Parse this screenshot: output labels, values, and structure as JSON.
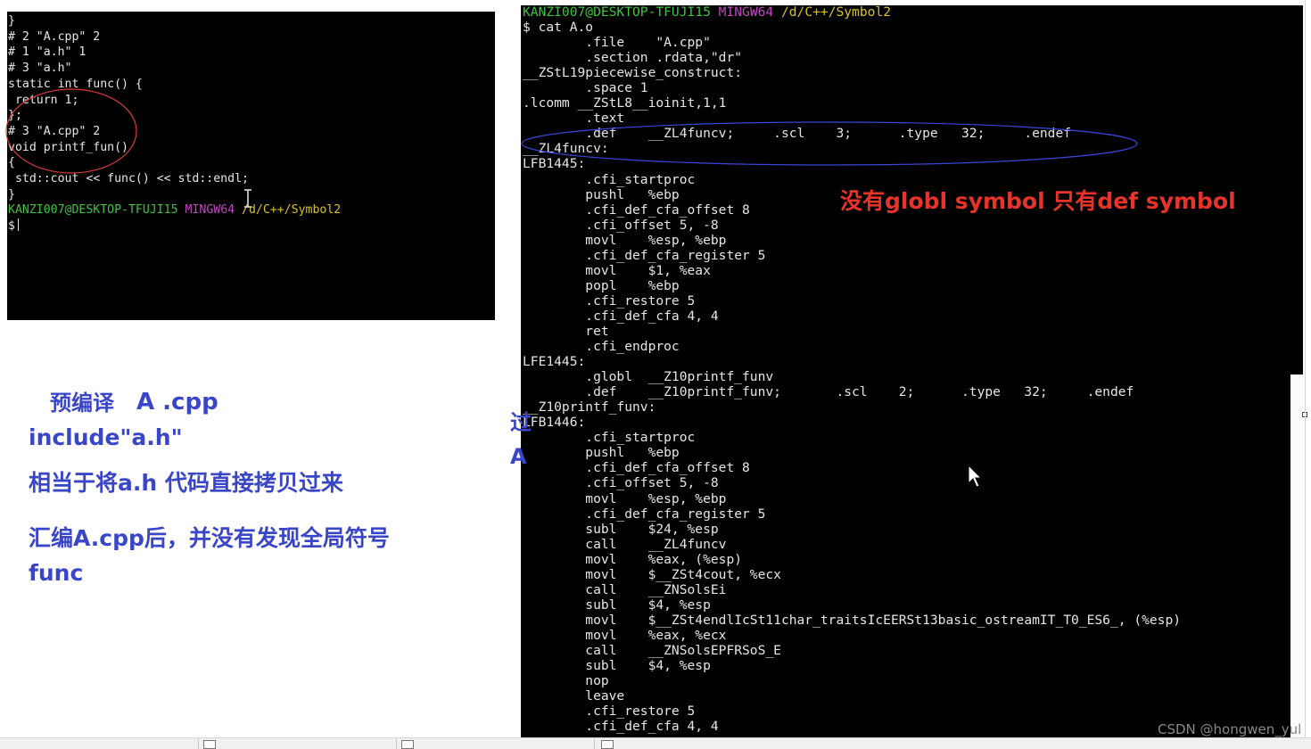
{
  "left_terminal": {
    "lines": [
      {
        "text": "}"
      },
      {
        "text": "# 2 \"A.cpp\" 2"
      },
      {
        "text": "# 1 \"a.h\" 1"
      },
      {
        "text": ""
      },
      {
        "text": ""
      },
      {
        "text": ""
      },
      {
        "text": "# 3 \"a.h\""
      },
      {
        "text": "static int func() {"
      },
      {
        "text": ""
      },
      {
        "text": " return 1;"
      },
      {
        "text": "};"
      },
      {
        "text": "# 3 \"A.cpp\" 2"
      },
      {
        "text": "void printf_fun()"
      },
      {
        "text": "{"
      },
      {
        "text": " std::cout << func() << std::endl;"
      },
      {
        "text": "}"
      },
      {
        "text": ""
      }
    ],
    "prompt_user": "KANZI007@DESKTOP-TFUJI15",
    "prompt_shell": "MINGW64",
    "prompt_path": "/d/C++/Symbol2",
    "prompt_symbol": "$"
  },
  "right_terminal": {
    "prompt_user": "KANZI007@DESKTOP-TFUJI15",
    "prompt_shell": "MINGW64",
    "prompt_path": "/d/C++/Symbol2",
    "lines": [
      {
        "text": "$ cat A.o"
      },
      {
        "text": "        .file    \"A.cpp\""
      },
      {
        "text": "        .section .rdata,\"dr\""
      },
      {
        "text": "__ZStL19piecewise_construct:"
      },
      {
        "text": "        .space 1"
      },
      {
        "text": ".lcomm __ZStL8__ioinit,1,1"
      },
      {
        "text": "        .text"
      },
      {
        "text": "        .def    __ZL4funcv;     .scl    3;      .type   32;     .endef"
      },
      {
        "text": "__ZL4funcv:"
      },
      {
        "text": "LFB1445:"
      },
      {
        "text": "        .cfi_startproc"
      },
      {
        "text": "        pushl   %ebp"
      },
      {
        "text": "        .cfi_def_cfa_offset 8"
      },
      {
        "text": "        .cfi_offset 5, -8"
      },
      {
        "text": "        movl    %esp, %ebp"
      },
      {
        "text": "        .cfi_def_cfa_register 5"
      },
      {
        "text": "        movl    $1, %eax"
      },
      {
        "text": "        popl    %ebp"
      },
      {
        "text": "        .cfi_restore 5"
      },
      {
        "text": "        .cfi_def_cfa 4, 4"
      },
      {
        "text": "        ret"
      },
      {
        "text": "        .cfi_endproc"
      },
      {
        "text": "LFE1445:"
      },
      {
        "text": "        .globl  __Z10printf_funv"
      },
      {
        "text": "        .def    __Z10printf_funv;       .scl    2;      .type   32;     .endef"
      },
      {
        "text": "__Z10printf_funv:"
      },
      {
        "text": "LFB1446:"
      },
      {
        "text": "        .cfi_startproc"
      },
      {
        "text": "        pushl   %ebp"
      },
      {
        "text": "        .cfi_def_cfa_offset 8"
      },
      {
        "text": "        .cfi_offset 5, -8"
      },
      {
        "text": "        movl    %esp, %ebp"
      },
      {
        "text": "        .cfi_def_cfa_register 5"
      },
      {
        "text": "        subl    $24, %esp"
      },
      {
        "text": "        call    __ZL4funcv"
      },
      {
        "text": "        movl    %eax, (%esp)"
      },
      {
        "text": "        movl    $__ZSt4cout, %ecx"
      },
      {
        "text": "        call    __ZNSolsEi"
      },
      {
        "text": "        subl    $4, %esp"
      },
      {
        "text": "        movl    $__ZSt4endlIcSt11char_traitsIcEERSt13basic_ostreamIT_T0_ES6_, (%esp)"
      },
      {
        "text": "        movl    %eax, %ecx"
      },
      {
        "text": "        call    __ZNSolsEPFRSoS_E"
      },
      {
        "text": "        subl    $4, %esp"
      },
      {
        "text": "        nop"
      },
      {
        "text": "        leave"
      },
      {
        "text": "        .cfi_restore 5"
      },
      {
        "text": "        .cfi_def_cfa 4, 4"
      }
    ]
  },
  "annotations": {
    "red_note": "没有globl symbol 只有def symbol",
    "note1": "预编译",
    "note1_file": "A .cpp",
    "note2": "include\"a.h\"",
    "note3": "相当于将a.h 代码直接拷贝过来",
    "note4": "汇编A.cpp后，并没有发现全局符号",
    "note5": "func",
    "partial_a": "过",
    "partial_b": "A"
  },
  "colors": {
    "terminal_bg": "#000000",
    "terminal_fg": "#e6e6e6",
    "prompt_green": "#3cc43c",
    "prompt_magenta": "#c046c0",
    "prompt_yellow": "#d6c22a",
    "red_annotation": "#e8332a",
    "blue_annotation": "#3a46c8"
  },
  "watermark": "CSDN @hongwen_yul",
  "icons": [
    "text-cursor-icon",
    "mouse-pointer-icon"
  ]
}
